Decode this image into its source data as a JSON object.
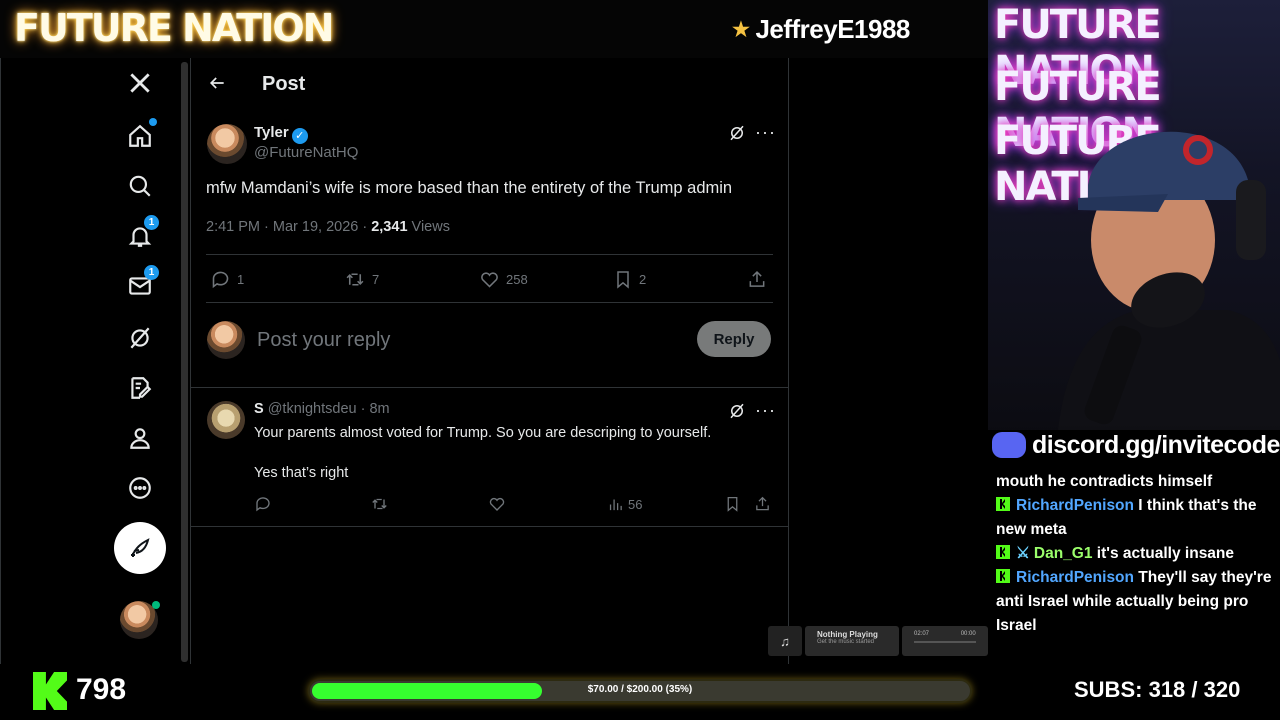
{
  "overlay": {
    "brand": "FUTURE NATION",
    "donor_name": "JeffreyE1988",
    "discord": "discord.gg/invitecode",
    "viewer_count": "798",
    "goal_text": "$70.00 / $200.00 (35%)",
    "goal_fraction": 0.35,
    "subs_label": "SUBS:",
    "subs_value": "318 / 320",
    "cam_banner_lines": [
      "FUTURE NATION",
      "FUTURE NATION",
      "FUTURE NATION"
    ]
  },
  "music": {
    "title": "Nothing Playing",
    "subtitle": "Get the music started",
    "time_current": "02:07",
    "time_total": "00:00"
  },
  "sidenav": {
    "notif_badge": "1",
    "messages_badge": "1",
    "icons": [
      "x-logo-icon",
      "home-icon",
      "search-icon",
      "notifications-icon",
      "messages-icon",
      "grok-icon",
      "premium-icon",
      "profile-icon",
      "more-icon"
    ]
  },
  "post": {
    "header_title": "Post",
    "author_name": "Tyler",
    "author_handle": "@FutureNatHQ",
    "text": "mfw Mamdani’s wife is more based than the entirety of the Trump admin",
    "timestamp": "2:41 PM · Mar 19, 2026 · ",
    "views_count": "2,341",
    "views_label": " Views",
    "replies": "1",
    "reposts": "7",
    "likes": "258",
    "bookmarks": "2",
    "reply_placeholder": "Post your reply",
    "reply_button": "Reply"
  },
  "reply": {
    "author_name": "S",
    "author_handle": "@tknightsdeu",
    "time": " · 8m",
    "text_line1": "Your parents almost voted for Trump. So you are descriping to yourself.",
    "text_line2": "Yes that’s right",
    "views": "56"
  },
  "chat": {
    "messages": [
      {
        "user": "",
        "text": "mouth he contradicts himself"
      },
      {
        "user": "RichardPenison",
        "text": " I think that's the new meta"
      },
      {
        "user": "Dan_G1",
        "text": " it's actually insane"
      },
      {
        "user": "RichardPenison",
        "text": " They'll say they're anti Israel while actually being pro Israel"
      }
    ]
  }
}
